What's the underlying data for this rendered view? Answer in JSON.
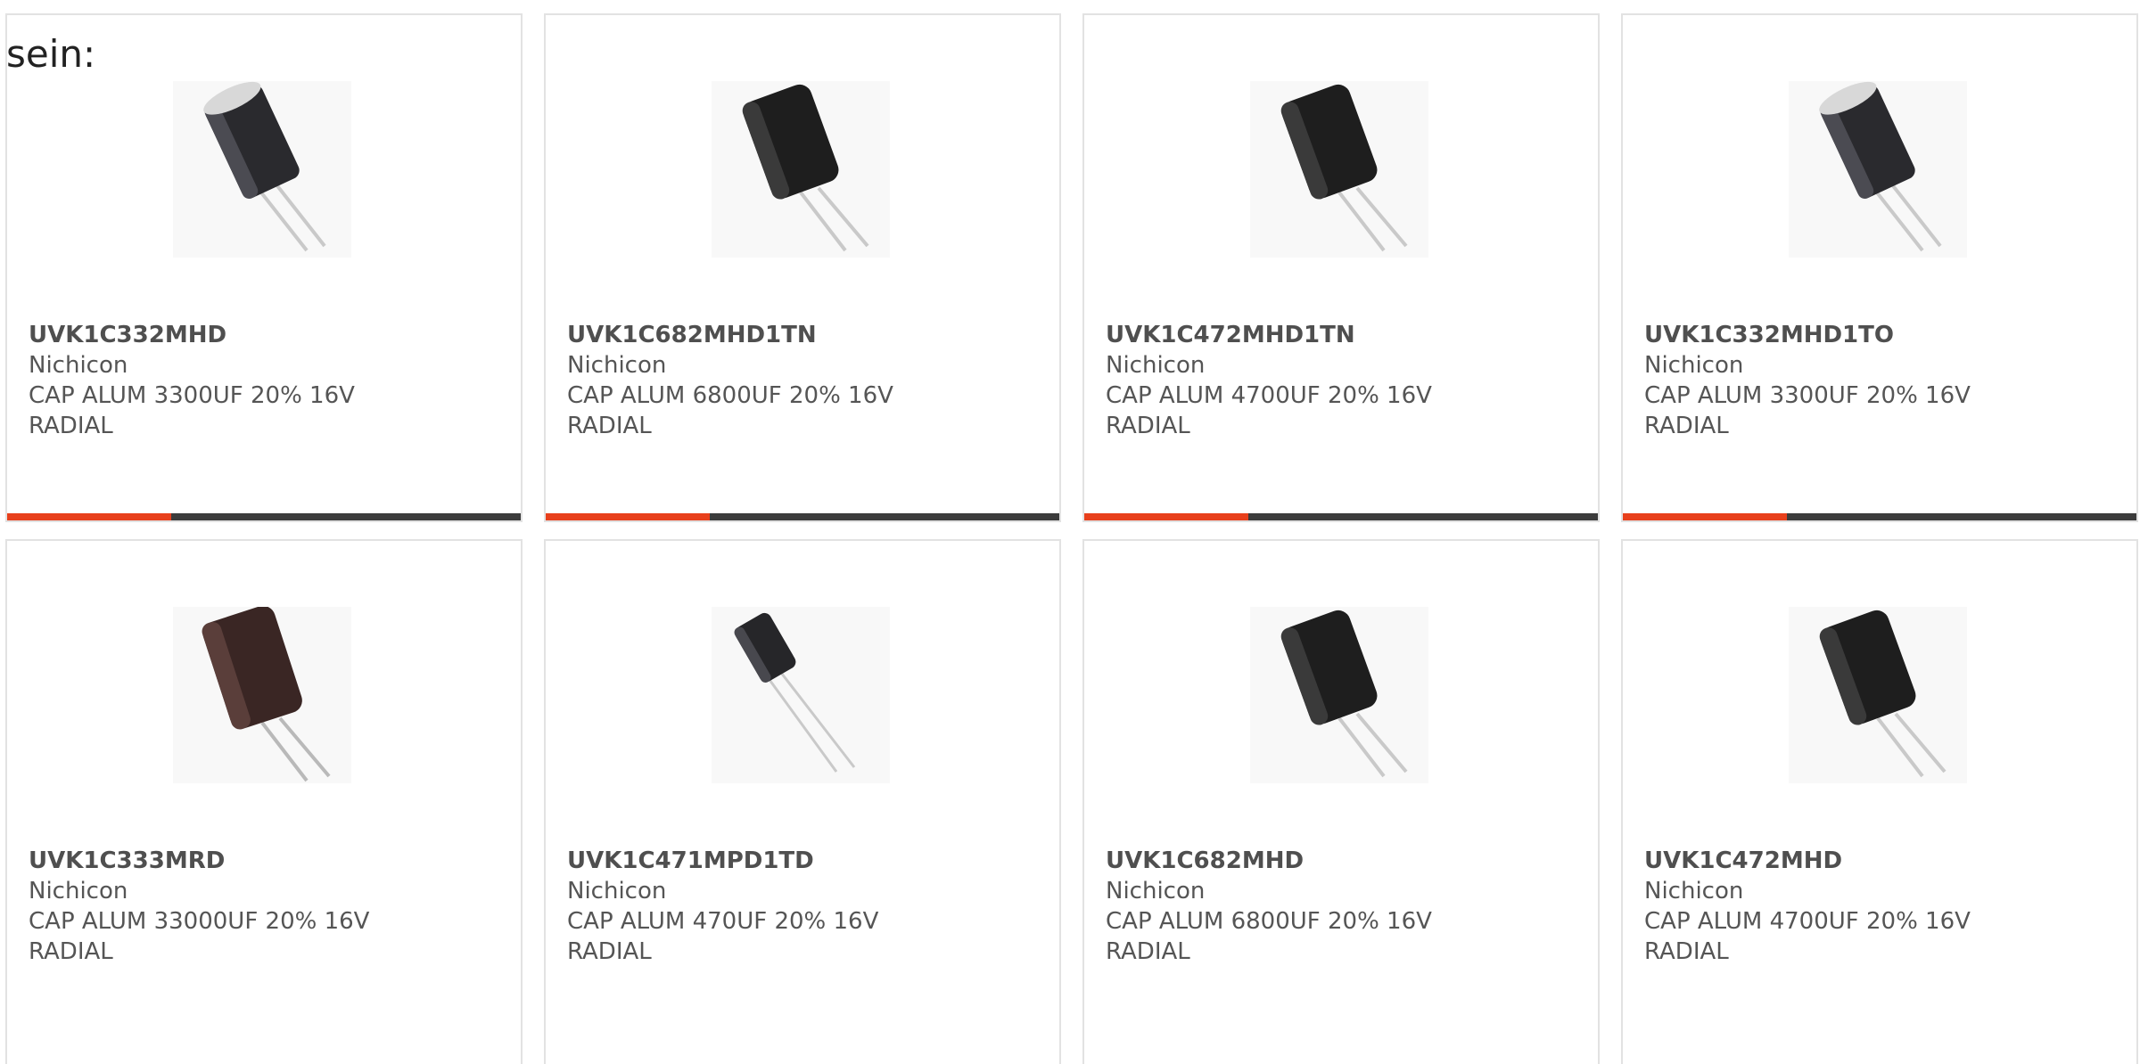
{
  "intro": "sein:",
  "colors": {
    "accent_orange": "#e8401c",
    "accent_dark": "#3c3c3c",
    "border": "#e2e2e2"
  },
  "products": [
    {
      "part": "UVK1C332MHD",
      "manufacturer": "Nichicon",
      "description": "CAP ALUM 3300UF 20% 16V RADIAL",
      "image": "capacitor-silver-top"
    },
    {
      "part": "UVK1C682MHD1TN",
      "manufacturer": "Nichicon",
      "description": "CAP ALUM 6800UF 20% 16V RADIAL",
      "image": "capacitor-black"
    },
    {
      "part": "UVK1C472MHD1TN",
      "manufacturer": "Nichicon",
      "description": "CAP ALUM 4700UF 20% 16V RADIAL",
      "image": "capacitor-black"
    },
    {
      "part": "UVK1C332MHD1TO",
      "manufacturer": "Nichicon",
      "description": "CAP ALUM 3300UF 20% 16V RADIAL",
      "image": "capacitor-silver-top"
    },
    {
      "part": "UVK1C333MRD",
      "manufacturer": "Nichicon",
      "description": "CAP ALUM 33000UF 20% 16V RADIAL",
      "image": "capacitor-brown"
    },
    {
      "part": "UVK1C471MPD1TD",
      "manufacturer": "Nichicon",
      "description": "CAP ALUM 470UF 20% 16V RADIAL",
      "image": "capacitor-small"
    },
    {
      "part": "UVK1C682MHD",
      "manufacturer": "Nichicon",
      "description": "CAP ALUM 6800UF 20% 16V RADIAL",
      "image": "capacitor-black"
    },
    {
      "part": "UVK1C472MHD",
      "manufacturer": "Nichicon",
      "description": "CAP ALUM 4700UF 20% 16V RADIAL",
      "image": "capacitor-black"
    }
  ]
}
